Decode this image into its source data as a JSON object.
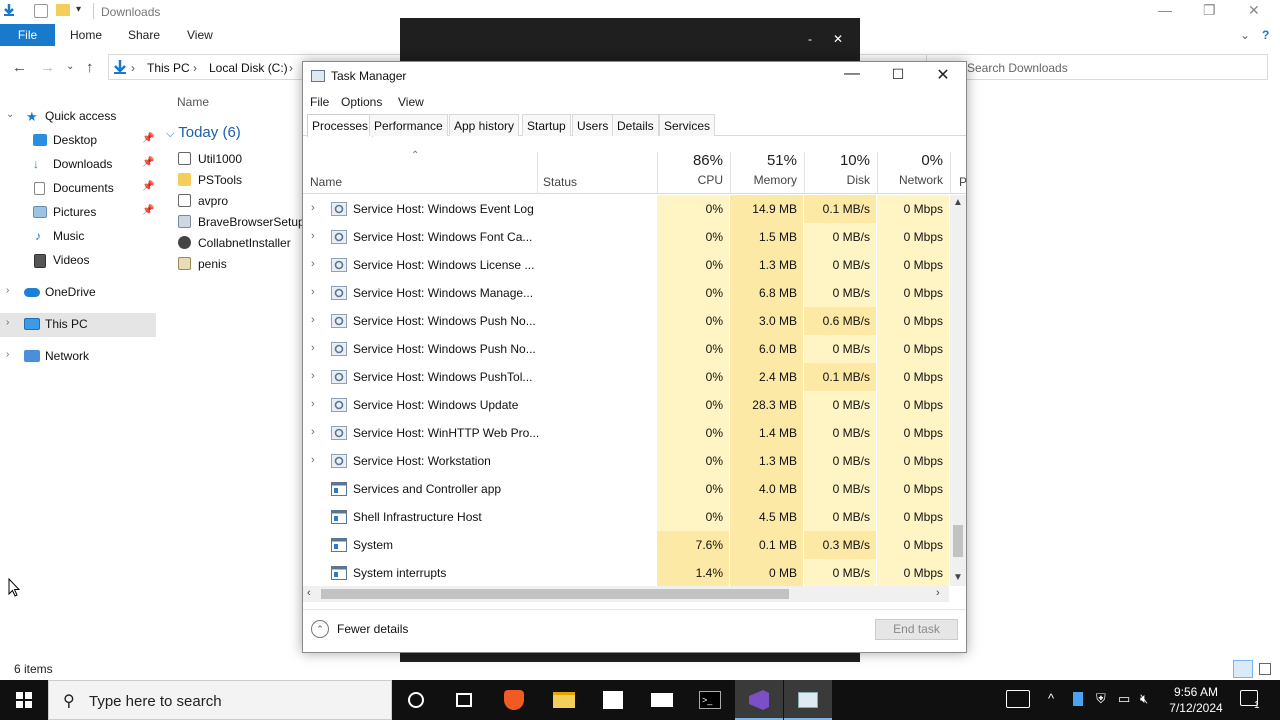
{
  "explorer": {
    "title": "Downloads",
    "ribbon": {
      "file": "File",
      "home": "Home",
      "share": "Share",
      "view": "View"
    },
    "breadcrumb": [
      "This PC",
      "Local Disk (C:)"
    ],
    "search_placeholder": "Search Downloads",
    "column_name": "Name",
    "group_label": "Today (6)",
    "files": [
      {
        "name": "Util1000",
        "icon": "app-icon"
      },
      {
        "name": "PSTools",
        "icon": "folder-icon"
      },
      {
        "name": "avpro",
        "icon": "app-icon"
      },
      {
        "name": "BraveBrowserSetup-",
        "icon": "installer-icon"
      },
      {
        "name": "CollabnetInstaller",
        "icon": "installer-icon"
      },
      {
        "name": "penis",
        "icon": "image-icon"
      }
    ],
    "nav": [
      {
        "label": "Quick access",
        "icon": "star-icon"
      },
      {
        "label": "Desktop",
        "icon": "desktop-icon"
      },
      {
        "label": "Downloads",
        "icon": "download-icon"
      },
      {
        "label": "Documents",
        "icon": "documents-icon"
      },
      {
        "label": "Pictures",
        "icon": "pictures-icon"
      },
      {
        "label": "Music",
        "icon": "music-icon"
      },
      {
        "label": "Videos",
        "icon": "videos-icon"
      },
      {
        "label": "OneDrive",
        "icon": "cloud-icon"
      },
      {
        "label": "This PC",
        "icon": "computer-icon"
      },
      {
        "label": "Network",
        "icon": "network-icon"
      }
    ],
    "status": "6 items"
  },
  "taskmanager": {
    "title": "Task Manager",
    "menu": [
      "File",
      "Options",
      "View"
    ],
    "tabs": [
      "Processes",
      "Performance",
      "App history",
      "Startup",
      "Users",
      "Details",
      "Services"
    ],
    "columns": {
      "name": "Name",
      "status": "Status",
      "cpu": {
        "pct": "86%",
        "label": "CPU"
      },
      "memory": {
        "pct": "51%",
        "label": "Memory"
      },
      "disk": {
        "pct": "10%",
        "label": "Disk"
      },
      "network": {
        "pct": "0%",
        "label": "Network"
      },
      "power_partial": "P"
    },
    "rows": [
      {
        "name": "Service Host: Windows Event Log",
        "cpu": "0%",
        "mem": "14.9 MB",
        "disk": "0.1 MB/s",
        "net": "0 Mbps",
        "expandable": true,
        "type": "service"
      },
      {
        "name": "Service Host: Windows Font Ca...",
        "cpu": "0%",
        "mem": "1.5 MB",
        "disk": "0 MB/s",
        "net": "0 Mbps",
        "expandable": true,
        "type": "service"
      },
      {
        "name": "Service Host: Windows License ...",
        "cpu": "0%",
        "mem": "1.3 MB",
        "disk": "0 MB/s",
        "net": "0 Mbps",
        "expandable": true,
        "type": "service"
      },
      {
        "name": "Service Host: Windows Manage...",
        "cpu": "0%",
        "mem": "6.8 MB",
        "disk": "0 MB/s",
        "net": "0 Mbps",
        "expandable": true,
        "type": "service"
      },
      {
        "name": "Service Host: Windows Push No...",
        "cpu": "0%",
        "mem": "3.0 MB",
        "disk": "0.6 MB/s",
        "net": "0 Mbps",
        "expandable": true,
        "type": "service"
      },
      {
        "name": "Service Host: Windows Push No...",
        "cpu": "0%",
        "mem": "6.0 MB",
        "disk": "0 MB/s",
        "net": "0 Mbps",
        "expandable": true,
        "type": "service"
      },
      {
        "name": "Service Host: Windows PushTol...",
        "cpu": "0%",
        "mem": "2.4 MB",
        "disk": "0.1 MB/s",
        "net": "0 Mbps",
        "expandable": true,
        "type": "service"
      },
      {
        "name": "Service Host: Windows Update",
        "cpu": "0%",
        "mem": "28.3 MB",
        "disk": "0 MB/s",
        "net": "0 Mbps",
        "expandable": true,
        "type": "service"
      },
      {
        "name": "Service Host: WinHTTP Web Pro...",
        "cpu": "0%",
        "mem": "1.4 MB",
        "disk": "0 MB/s",
        "net": "0 Mbps",
        "expandable": true,
        "type": "service"
      },
      {
        "name": "Service Host: Workstation",
        "cpu": "0%",
        "mem": "1.3 MB",
        "disk": "0 MB/s",
        "net": "0 Mbps",
        "expandable": true,
        "type": "service"
      },
      {
        "name": "Services and Controller app",
        "cpu": "0%",
        "mem": "4.0 MB",
        "disk": "0 MB/s",
        "net": "0 Mbps",
        "expandable": false,
        "type": "app"
      },
      {
        "name": "Shell Infrastructure Host",
        "cpu": "0%",
        "mem": "4.5 MB",
        "disk": "0 MB/s",
        "net": "0 Mbps",
        "expandable": false,
        "type": "app"
      },
      {
        "name": "System",
        "cpu": "7.6%",
        "mem": "0.1 MB",
        "disk": "0.3 MB/s",
        "net": "0 Mbps",
        "expandable": false,
        "type": "app"
      },
      {
        "name": "System interrupts",
        "cpu": "1.4%",
        "mem": "0 MB",
        "disk": "0 MB/s",
        "net": "0 Mbps",
        "expandable": false,
        "type": "app"
      }
    ],
    "footer": {
      "fewer": "Fewer details",
      "end_task": "End task"
    }
  },
  "taskbar": {
    "search_placeholder": "Type here to search",
    "time": "9:56 AM",
    "date": "7/12/2024",
    "notification_count": "1"
  },
  "colors": {
    "heat_low": "#fff4c4",
    "heat_mid": "#fde9a6",
    "accent": "#1979ca",
    "taskbar": "#101010"
  }
}
